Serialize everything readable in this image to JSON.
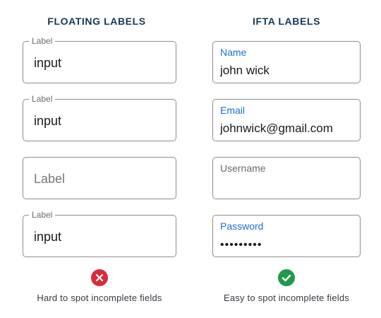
{
  "floating": {
    "title": "FLOATING LABELS",
    "fields": [
      {
        "label": "Label",
        "value": "input"
      },
      {
        "label": "Label",
        "value": "input"
      },
      {
        "placeholder": "Label"
      },
      {
        "label": "Label",
        "value": "input"
      }
    ],
    "status_icon": "error-x-icon",
    "status_color": "#d92b3a",
    "status_text": "Hard to spot incomplete fields"
  },
  "ifta": {
    "title": "IFTA LABELS",
    "fields": [
      {
        "label": "Name",
        "value": "john wick"
      },
      {
        "label": "Email",
        "value": "johnwick@gmail.com"
      },
      {
        "label": "Username",
        "value": ""
      },
      {
        "label": "Password",
        "value": "•••••••••"
      }
    ],
    "status_icon": "check-icon",
    "status_color": "#1f9a4a",
    "status_text": "Easy to spot incomplete fields"
  }
}
